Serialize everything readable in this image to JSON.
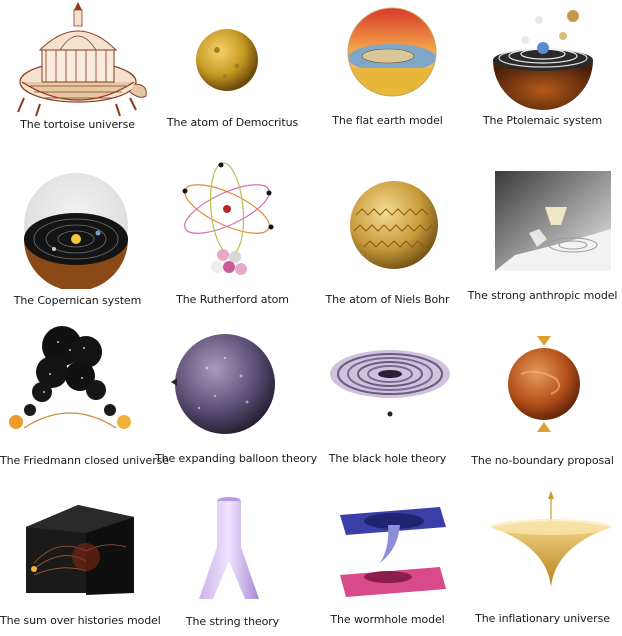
{
  "items": [
    {
      "name": "tortoise-universe",
      "label": "The tortoise universe"
    },
    {
      "name": "atom-of-democritus",
      "label": "The atom of Democritus"
    },
    {
      "name": "flat-earth-model",
      "label": "The flat earth model"
    },
    {
      "name": "ptolemaic-system",
      "label": "The Ptolemaic system"
    },
    {
      "name": "copernican-system",
      "label": "The Copernican system"
    },
    {
      "name": "rutherford-atom",
      "label": "The Rutherford atom"
    },
    {
      "name": "atom-of-niels-bohr",
      "label": "The atom of Niels Bohr"
    },
    {
      "name": "strong-anthropic-model",
      "label": "The strong anthropic model"
    },
    {
      "name": "friedmann-closed-universe",
      "label": "The Friedmann closed universe"
    },
    {
      "name": "expanding-balloon-theory",
      "label": "The expanding balloon theory"
    },
    {
      "name": "black-hole-theory",
      "label": "The black hole theory"
    },
    {
      "name": "no-boundary-proposal",
      "label": "The no-boundary proposal"
    },
    {
      "name": "sum-over-histories-model",
      "label": "The sum over histories model"
    },
    {
      "name": "string-theory",
      "label": "The string theory"
    },
    {
      "name": "wormhole-model",
      "label": "The wormhole model"
    },
    {
      "name": "inflationary-universe",
      "label": "The inflationary universe"
    }
  ]
}
